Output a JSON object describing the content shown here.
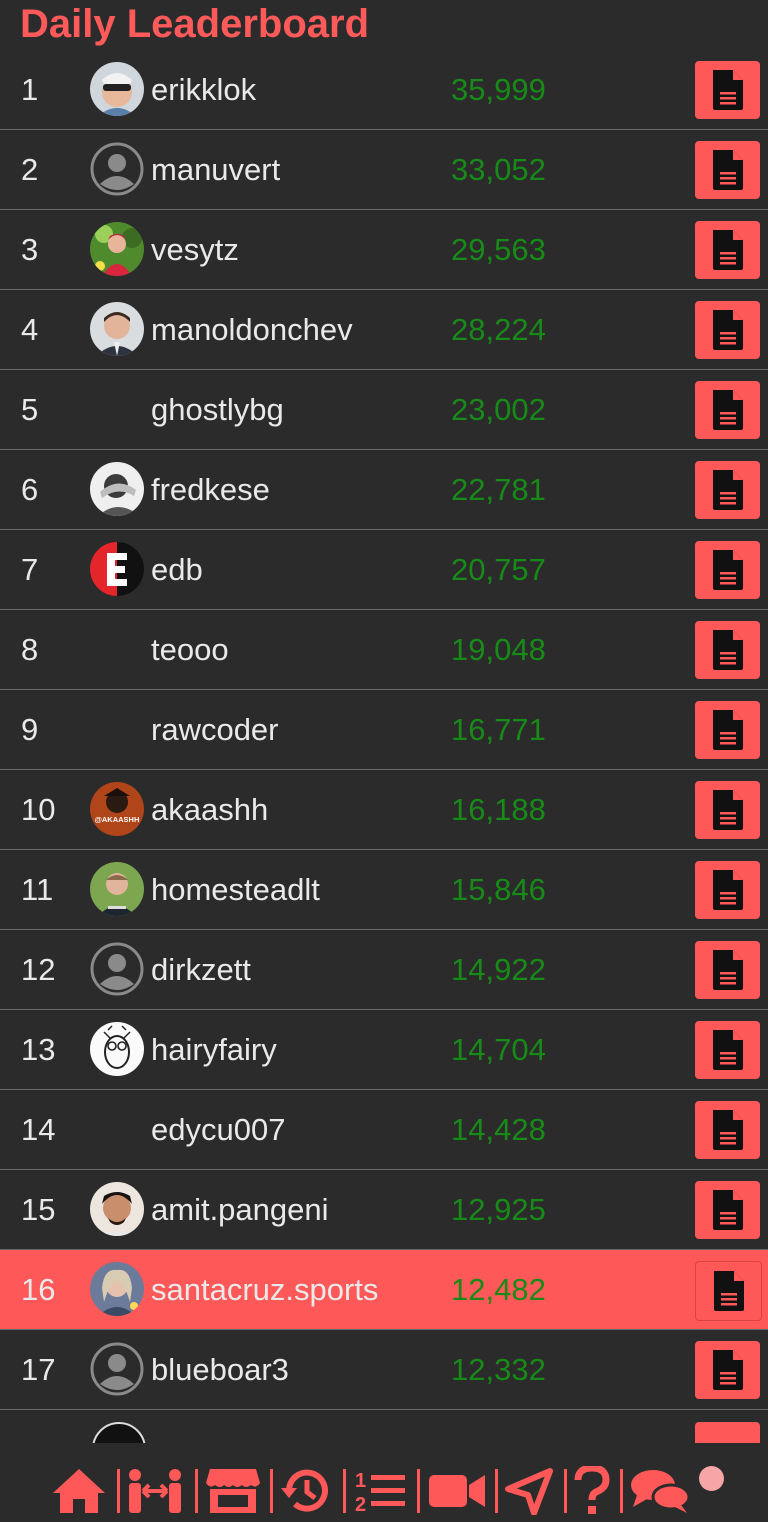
{
  "header": {
    "title": "Daily Leaderboard"
  },
  "colors": {
    "accent": "#ff5858",
    "score": "#178a17",
    "background": "#2b2b2b"
  },
  "leaderboard": [
    {
      "rank": "1",
      "username": "erikklok",
      "score": "35,999",
      "avatar": "photo-sunglasses"
    },
    {
      "rank": "2",
      "username": "manuvert",
      "score": "33,052",
      "avatar": "default-user-icon"
    },
    {
      "rank": "3",
      "username": "vesytz",
      "score": "29,563",
      "avatar": "photo-outdoor"
    },
    {
      "rank": "4",
      "username": "manoldonchev",
      "score": "28,224",
      "avatar": "photo-man"
    },
    {
      "rank": "5",
      "username": "ghostlybg",
      "score": "23,002",
      "avatar": "none"
    },
    {
      "rank": "6",
      "username": "fredkese",
      "score": "22,781",
      "avatar": "photo-bw"
    },
    {
      "rank": "7",
      "username": "edb",
      "score": "20,757",
      "avatar": "logo-e"
    },
    {
      "rank": "8",
      "username": "teooo",
      "score": "19,048",
      "avatar": "none"
    },
    {
      "rank": "9",
      "username": "rawcoder",
      "score": "16,771",
      "avatar": "none"
    },
    {
      "rank": "10",
      "username": "akaashh",
      "score": "16,188",
      "avatar": "logo-akaashh",
      "avatar_text": "@AKAASHH"
    },
    {
      "rank": "11",
      "username": "homesteadlt",
      "score": "15,846",
      "avatar": "photo-man-outdoor"
    },
    {
      "rank": "12",
      "username": "dirkzett",
      "score": "14,922",
      "avatar": "default-user-icon"
    },
    {
      "rank": "13",
      "username": "hairyfairy",
      "score": "14,704",
      "avatar": "sketch-owl"
    },
    {
      "rank": "14",
      "username": "edycu007",
      "score": "14,428",
      "avatar": "none"
    },
    {
      "rank": "15",
      "username": "amit.pangeni",
      "score": "12,925",
      "avatar": "photo-young-man"
    },
    {
      "rank": "16",
      "username": "santacruz.sports",
      "score": "12,482",
      "avatar": "photo-woman",
      "highlighted": true
    },
    {
      "rank": "17",
      "username": "blueboar3",
      "score": "12,332",
      "avatar": "default-user-icon"
    }
  ],
  "row_action_icon": "document-icon",
  "bottom_nav": [
    "home-icon",
    "people-exchange-icon",
    "store-icon",
    "history-icon",
    "ranked-list-icon",
    "video-camera-icon",
    "share-icon",
    "question-icon",
    "chat-icon",
    "notification-dot"
  ]
}
